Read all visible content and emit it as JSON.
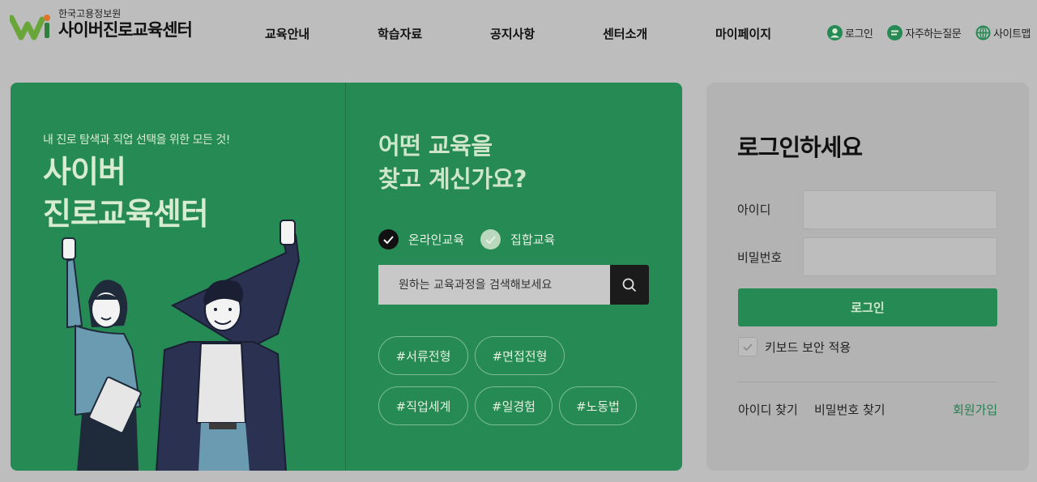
{
  "header": {
    "org_name": "한국고용정보원",
    "site_title": "사이버진로교육센터",
    "nav": [
      {
        "label": "교육안내"
      },
      {
        "label": "학습자료"
      },
      {
        "label": "공지사항"
      },
      {
        "label": "센터소개"
      },
      {
        "label": "마이페이지"
      }
    ],
    "util": {
      "login": "로그인",
      "faq": "자주하는질문",
      "sitemap": "사이트맵"
    }
  },
  "hero": {
    "subtitle": "내 진로 탐색과 직업 선택을 위한 모든 것!",
    "title_line1": "사이버",
    "title_line2": "진로교육센터"
  },
  "search": {
    "question_line1": "어떤 교육을",
    "question_line2": "찾고 계신가요?",
    "options": [
      {
        "label": "온라인교육",
        "selected": true
      },
      {
        "label": "집합교육",
        "selected": false
      }
    ],
    "placeholder": "원하는 교육과정을 검색해보세요",
    "tags": [
      "#서류전형",
      "#면접전형",
      "#직업세계",
      "#일경험",
      "#노동법"
    ]
  },
  "login": {
    "title": "로그인하세요",
    "id_label": "아이디",
    "pw_label": "비밀번호",
    "submit_label": "로그인",
    "keyboard_security_label": "키보드 보안 적용",
    "keyboard_security_checked": true,
    "find_id": "아이디 찾기",
    "find_pw": "비밀번호 찾기",
    "join": "회원가입"
  },
  "colors": {
    "brand_green": "#268a55",
    "dark": "#1b1b1b"
  }
}
